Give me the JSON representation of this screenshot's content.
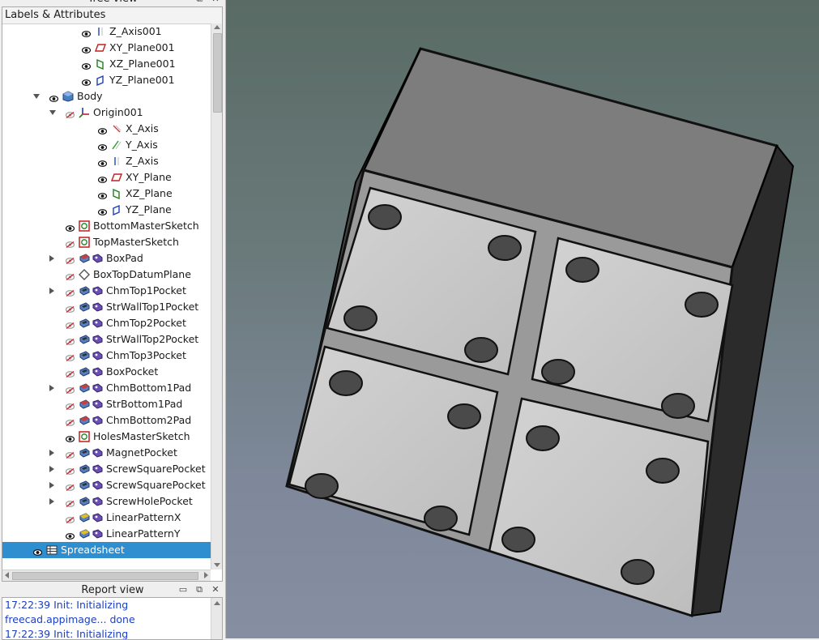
{
  "tree_view": {
    "title": "Tree view",
    "header": "Labels & Attributes",
    "rows": [
      {
        "label": "Z_Axis001",
        "indent": 3,
        "visible": true,
        "icon": "z-axis-icon",
        "expander": "none"
      },
      {
        "label": "XY_Plane001",
        "indent": 3,
        "visible": true,
        "icon": "xy-plane-icon",
        "expander": "none"
      },
      {
        "label": "XZ_Plane001",
        "indent": 3,
        "visible": true,
        "icon": "xz-plane-icon",
        "expander": "none"
      },
      {
        "label": "YZ_Plane001",
        "indent": 3,
        "visible": true,
        "icon": "yz-plane-icon",
        "expander": "none"
      },
      {
        "label": "Body",
        "indent": 1,
        "visible": true,
        "icon": "body-icon",
        "expander": "down"
      },
      {
        "label": "Origin001",
        "indent": 2,
        "visible": false,
        "icon": "origin-icon",
        "expander": "down"
      },
      {
        "label": "X_Axis",
        "indent": 4,
        "visible": true,
        "icon": "x-axis-icon",
        "expander": "none"
      },
      {
        "label": "Y_Axis",
        "indent": 4,
        "visible": true,
        "icon": "y-axis-icon",
        "expander": "none"
      },
      {
        "label": "Z_Axis",
        "indent": 4,
        "visible": true,
        "icon": "z-axis-icon",
        "expander": "none"
      },
      {
        "label": "XY_Plane",
        "indent": 4,
        "visible": true,
        "icon": "xy-plane-icon",
        "expander": "none"
      },
      {
        "label": "XZ_Plane",
        "indent": 4,
        "visible": true,
        "icon": "xz-plane-icon",
        "expander": "none"
      },
      {
        "label": "YZ_Plane",
        "indent": 4,
        "visible": true,
        "icon": "yz-plane-icon",
        "expander": "none"
      },
      {
        "label": "BottomMasterSketch",
        "indent": 2,
        "visible": true,
        "icon": "sketch-icon",
        "expander": "none"
      },
      {
        "label": "TopMasterSketch",
        "indent": 2,
        "visible": false,
        "icon": "sketch-icon",
        "expander": "none"
      },
      {
        "label": "BoxPad",
        "indent": 2,
        "visible": false,
        "icon": "pad-icon",
        "expander": "right",
        "dual": true
      },
      {
        "label": "BoxTopDatumPlane",
        "indent": 2,
        "visible": false,
        "icon": "datum-plane-icon",
        "expander": "none"
      },
      {
        "label": "ChmTop1Pocket",
        "indent": 2,
        "visible": false,
        "icon": "pocket-icon",
        "expander": "right",
        "dual": true
      },
      {
        "label": "StrWallTop1Pocket",
        "indent": 2,
        "visible": false,
        "icon": "pocket-icon",
        "expander": "none",
        "dual": true
      },
      {
        "label": "ChmTop2Pocket",
        "indent": 2,
        "visible": false,
        "icon": "pocket-icon",
        "expander": "none",
        "dual": true
      },
      {
        "label": "StrWallTop2Pocket",
        "indent": 2,
        "visible": false,
        "icon": "pocket-icon",
        "expander": "none",
        "dual": true
      },
      {
        "label": "ChmTop3Pocket",
        "indent": 2,
        "visible": false,
        "icon": "pocket-icon",
        "expander": "none",
        "dual": true
      },
      {
        "label": "BoxPocket",
        "indent": 2,
        "visible": false,
        "icon": "pocket-icon",
        "expander": "none",
        "dual": true
      },
      {
        "label": "ChmBottom1Pad",
        "indent": 2,
        "visible": false,
        "icon": "pad-icon",
        "expander": "right",
        "dual": true
      },
      {
        "label": "StrBottom1Pad",
        "indent": 2,
        "visible": false,
        "icon": "pad-icon",
        "expander": "none",
        "dual": true
      },
      {
        "label": "ChmBottom2Pad",
        "indent": 2,
        "visible": false,
        "icon": "pad-icon",
        "expander": "none",
        "dual": true
      },
      {
        "label": "HolesMasterSketch",
        "indent": 2,
        "visible": true,
        "icon": "sketch-icon",
        "expander": "none"
      },
      {
        "label": "MagnetPocket",
        "indent": 2,
        "visible": false,
        "icon": "pocket-icon",
        "expander": "right",
        "dual": true
      },
      {
        "label": "ScrewSquarePocket",
        "indent": 2,
        "visible": false,
        "icon": "pocket-icon",
        "expander": "right",
        "dual": true
      },
      {
        "label": "ScrewSquarePocket",
        "indent": 2,
        "visible": false,
        "icon": "pocket-icon",
        "expander": "right",
        "dual": true
      },
      {
        "label": "ScrewHolePocket",
        "indent": 2,
        "visible": false,
        "icon": "pocket-icon",
        "expander": "right",
        "dual": true
      },
      {
        "label": "LinearPatternX",
        "indent": 2,
        "visible": false,
        "icon": "linear-pattern-icon",
        "expander": "none",
        "dual": true
      },
      {
        "label": "LinearPatternY",
        "indent": 2,
        "visible": true,
        "icon": "linear-pattern-icon",
        "expander": "none",
        "dual": true
      },
      {
        "label": "Spreadsheet",
        "indent": 0,
        "visible": true,
        "icon": "spreadsheet-icon",
        "expander": "none",
        "selected": true
      }
    ]
  },
  "report_view": {
    "title": "Report view",
    "lines": [
      "17:22:39  Init: Initializing",
      "freecad.appimage... done",
      "17:22:39  Init: Initializing"
    ]
  },
  "colors": {
    "selection": "#2f8ed0",
    "report_text": "#1a3fc4",
    "view_top": "#596b64",
    "view_bottom": "#868fa2"
  }
}
